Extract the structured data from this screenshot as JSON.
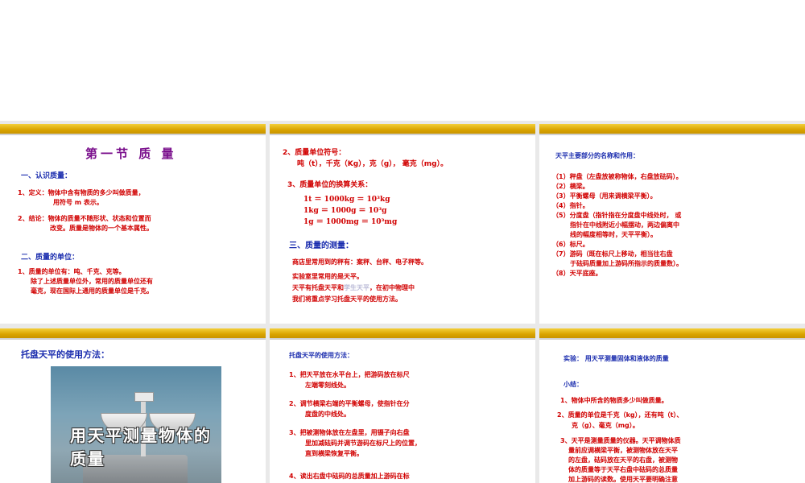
{
  "slide1": {
    "title": "第一节  质 量",
    "h1": "一、认识质量：",
    "p1a": "1、定义：物体中含有物质的多少叫做质量，",
    "p1b": "用符号 m 表示。",
    "p2a": "2、结论：物体的质量不随形状、状态和位置而",
    "p2b": "改变。质量是物体的一个基本属性。",
    "h2": "二、质量的单位：",
    "p3a": "1、质量的单位有：吨、千克、克等。",
    "p3b": "除了上述质量单位外，常用的质量单位还有",
    "p3c": "毫克，现在国际上通用的质量单位是千克。"
  },
  "slide2": {
    "l1": "2、质量单位符号：",
    "l2": "吨（t），千克（Kg），克（g），  毫克（mg）。",
    "l3": "3、质量单位的换算关系：",
    "l4": "1t  ＝  1000kg  ＝  10³kg",
    "l5": "1kg  ＝  1000g  ＝  10³g",
    "l6": "1g  ＝  1000mg  ＝  10³mg",
    "h3": "三、质量的测量：",
    "l7": "商店里常用到的秤有：案秤、台秤、电子秤等。",
    "l8": "实验室里常用的是天平。",
    "l9a": "天平有托盘天平和",
    "l9b": "学生天平",
    "l9c": "，在初中物理中",
    "l10": "我们将重点学习托盘天平的使用方法。"
  },
  "slide3": {
    "title": "天平主要部分的名称和作用：",
    "i1": "（1）秤盘（左盘放被称物体，右盘放砝码）。",
    "i2": "（2）横梁。",
    "i3": "（3）平衡螺母（用来调横梁平衡）。",
    "i4": "（4）指针。",
    "i5a": "（5）分度盘（指针指在分度盘中线处时，  或",
    "i5b": "指针在中线附近小幅摆动，两边偏离中",
    "i5c": "线的幅度相等时，天平平衡）。",
    "i6": "（6）标尺。",
    "i7a": "（7）游码（既在标尺上移动，相当往右盘",
    "i7b": "于砝码质量加上游码所指示的质量数）。",
    "i8": "（8）天平底座。"
  },
  "slide4": {
    "title": "托盘天平的使用方法：",
    "caption": "用天平测量物体的质量"
  },
  "slide5": {
    "title": "托盘天平的使用方法：",
    "s1a": "1、把天平放在水平台上，把游码放在标尺",
    "s1b": "左端零刻线处。",
    "s2a": "2、调节横梁右端的平衡螺母，使指针在分",
    "s2b": "度盘的中线处。",
    "s3a": "3、把被测物体放在左盘里，用镊子向右盘",
    "s3b": "里加减砝码并调节游码在标尺上的位置，",
    "s3c": "直到横梁恢复平衡。",
    "s4a": "4、读出右盘中砝码的总质量加上游码在标"
  },
  "slide6": {
    "title": "实验：  用天平测量固体和液体的质量",
    "summary": "小结：",
    "k1": "1、物体中所含的物质多少叫做质量。",
    "k2a": "2、质量的单位是千克（kg），还有吨（t）、",
    "k2b": "克（g）、毫克（mg）。",
    "k3a": "3、天平是测量质量的仪器。天平调物体质",
    "k3b": "量前应调横梁平衡，被测物体放在天平",
    "k3c": "的左盘，砝码放在天平的右盘，被测物",
    "k3d": "体的质量等于天平右盘中砝码的总质量",
    "k3e": "加上游码的读数。使用天平要明确注意"
  }
}
